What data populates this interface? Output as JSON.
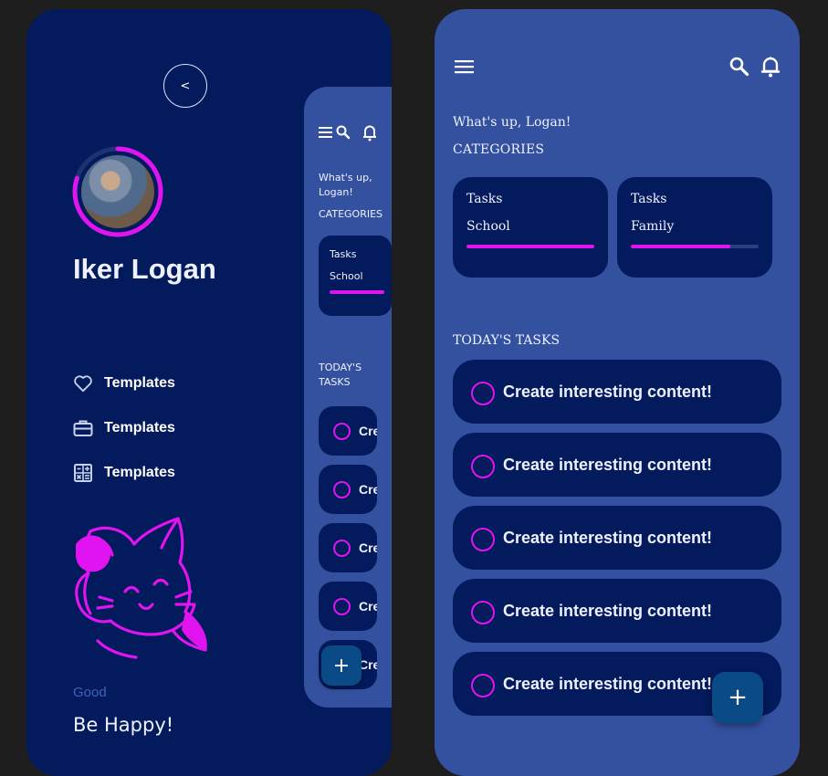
{
  "colors": {
    "background": "#1e1e1e",
    "drawer_bg": "#031a5c",
    "home_bg": "#3451a0",
    "card_bg": "#031a5c",
    "accent": "#e014f0",
    "fab_bg": "#0a4a86",
    "text": "#eef2ff",
    "muted": "#3f63b8"
  },
  "drawer": {
    "back_label": "<",
    "avatar_progress": 0.8,
    "profile_name": "Iker Logan",
    "menu": [
      {
        "label": "Templates",
        "icon": "heart-icon"
      },
      {
        "label": "Templates",
        "icon": "briefcase-icon"
      },
      {
        "label": "Templates",
        "icon": "calculator-icon"
      }
    ],
    "illustration": "lucky-cat-illustration",
    "mood_small": "Good",
    "mood_big": "Be Happy!"
  },
  "mini_home": {
    "greeting": "What's up, Logan!",
    "categories_title": "CATEGORIES",
    "category": {
      "label": "Tasks",
      "name": "School",
      "progress": 1.0
    },
    "tasks_title": "TODAY'S TASKS",
    "task_text": "Cre",
    "fab_label": "+"
  },
  "home": {
    "icons": {
      "menu": "hamburger-menu-icon",
      "search": "search-icon",
      "bell": "bell-icon"
    },
    "greeting": "What's up, Logan!",
    "categories_title": "CATEGORIES",
    "categories": [
      {
        "label": "Tasks",
        "name": "School",
        "progress": 1.0
      },
      {
        "label": "Tasks",
        "name": "Family",
        "progress": 0.78
      }
    ],
    "tasks_title": "TODAY'S TASKS",
    "tasks": [
      "Create interesting content!",
      "Create interesting content!",
      "Create interesting content!",
      "Create interesting content!",
      "Create interesting content!"
    ],
    "fab_label": "+"
  }
}
